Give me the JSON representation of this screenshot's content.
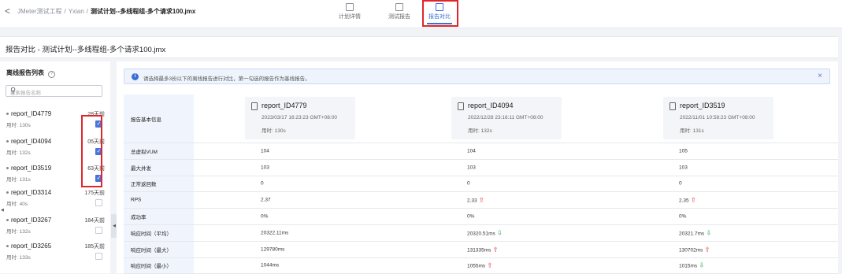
{
  "breadcrumb": {
    "back": "<",
    "items": [
      "JMeter测试工程",
      "Yxian"
    ],
    "current": "测试计划--多线程组-多个请求100.jmx"
  },
  "tabs": [
    {
      "label": "计划详情"
    },
    {
      "label": "测试报告"
    },
    {
      "label": "报告对比"
    }
  ],
  "page_title": "报告对比 - 测试计划--多线程组-多个请求100.jmx",
  "sidebar": {
    "heading": "离线报告列表",
    "help": "?",
    "search_placeholder": "搜索报告名称",
    "reports": [
      {
        "name": "report_ID4779",
        "time": "用时: 130s",
        "ago": "28天前",
        "checked": true
      },
      {
        "name": "report_ID4094",
        "time": "用时: 132s",
        "ago": "05天前",
        "checked": true
      },
      {
        "name": "report_ID3519",
        "time": "用时: 131s",
        "ago": "63天前",
        "checked": true
      },
      {
        "name": "report_ID3314",
        "time": "用时: 40s",
        "ago": "175天前",
        "checked": false
      },
      {
        "name": "report_ID3267",
        "time": "用时: 132s",
        "ago": "184天前",
        "checked": false
      },
      {
        "name": "report_ID3265",
        "time": "用时: 133s",
        "ago": "185天前",
        "checked": false
      }
    ]
  },
  "notice": "请选择最多3份以下的离线报告进行对比，第一勾选的报告作为基线报告。",
  "table": {
    "header_label": "报告基本信息",
    "cards": [
      {
        "name": "report_ID4779",
        "date": "2023/03/17 16:23:23 GMT+08:00",
        "time": "用时: 130s"
      },
      {
        "name": "report_ID4094",
        "date": "2022/12/28 23:16:11 GMT+08:00",
        "time": "用时: 132s"
      },
      {
        "name": "report_ID3519",
        "date": "2022/11/01 10:58:23 GMT+08:00",
        "time": "用时: 131s"
      }
    ],
    "rows": [
      {
        "label": "总虚拟VUM",
        "values": [
          "104",
          "104",
          "105"
        ],
        "trend": [
          "",
          "",
          ""
        ]
      },
      {
        "label": "最大并发",
        "values": [
          "103",
          "103",
          "103"
        ],
        "trend": [
          "",
          "",
          ""
        ]
      },
      {
        "label": "正常返回数",
        "values": [
          "0",
          "0",
          "0"
        ],
        "trend": [
          "",
          "",
          ""
        ]
      },
      {
        "label": "RPS",
        "values": [
          "2.37",
          "2.33",
          "2.35"
        ],
        "trend": [
          "",
          "up",
          "up"
        ]
      },
      {
        "label": "成功率",
        "values": [
          "0%",
          "0%",
          "0%"
        ],
        "trend": [
          "",
          "",
          ""
        ]
      },
      {
        "label": "响应时间（平均）",
        "values": [
          "20322.11ms",
          "20320.51ms",
          "20321.7ms"
        ],
        "trend": [
          "",
          "down",
          "down"
        ]
      },
      {
        "label": "响应时间（最大）",
        "values": [
          "129780ms",
          "131335ms",
          "130702ms"
        ],
        "trend": [
          "",
          "up",
          "up"
        ]
      },
      {
        "label": "响应时间（最小）",
        "values": [
          "1044ms",
          "1055ms",
          "1015ms"
        ],
        "trend": [
          "",
          "up",
          "down"
        ]
      }
    ]
  },
  "colors": {
    "accent": "#3a6fd8",
    "highlight": "#e0262c",
    "up": "#e0262c",
    "down": "#19a34a"
  }
}
